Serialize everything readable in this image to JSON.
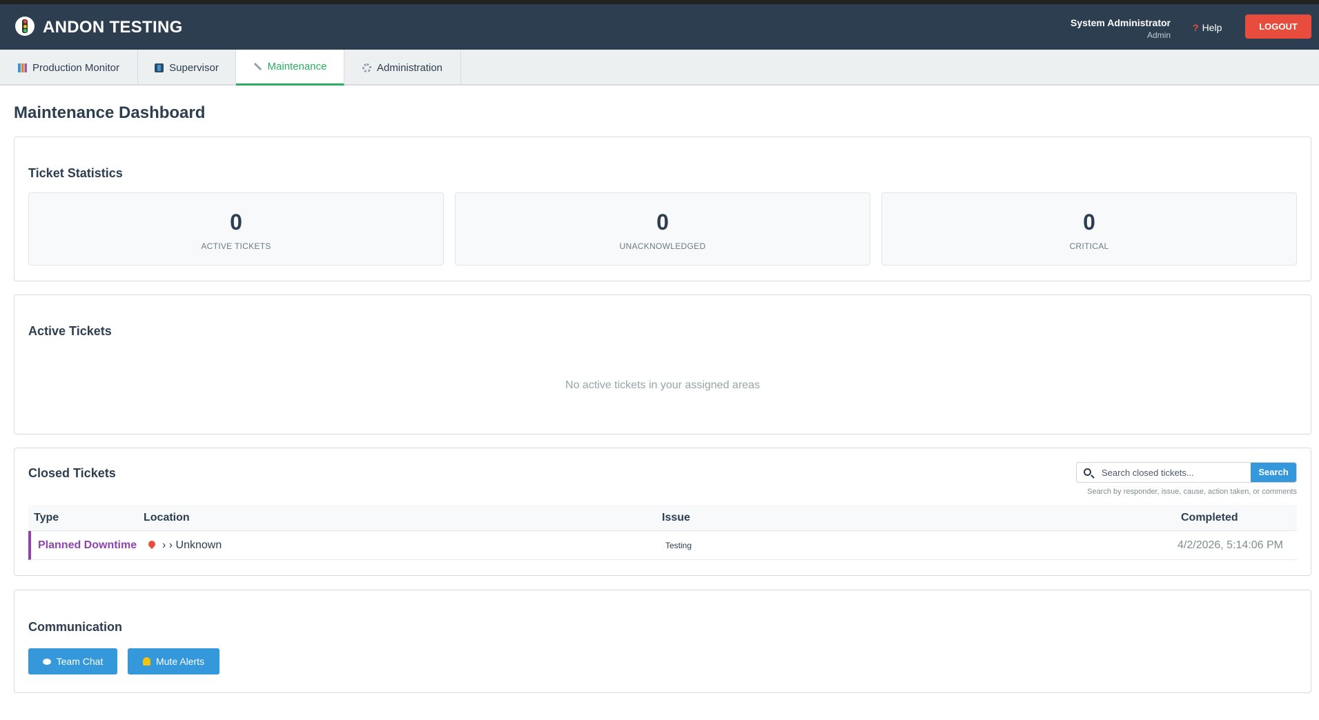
{
  "app": {
    "title": "ANDON TESTING",
    "user_name": "System Administrator",
    "user_role": "Admin",
    "help_label": "Help",
    "logout_label": "LOGOUT"
  },
  "tabs": [
    {
      "label": "Production Monitor",
      "icon": "chart-icon"
    },
    {
      "label": "Supervisor",
      "icon": "supervisor-icon"
    },
    {
      "label": "Maintenance",
      "icon": "wrench-icon",
      "active": true
    },
    {
      "label": "Administration",
      "icon": "gear-icon"
    }
  ],
  "page": {
    "title": "Maintenance Dashboard"
  },
  "stats": {
    "title": "Ticket Statistics",
    "items": [
      {
        "value": "0",
        "label": "ACTIVE TICKETS"
      },
      {
        "value": "0",
        "label": "UNACKNOWLEDGED"
      },
      {
        "value": "0",
        "label": "CRITICAL"
      }
    ]
  },
  "active_tickets": {
    "title": "Active Tickets",
    "empty_message": "No active tickets in your assigned areas"
  },
  "closed_tickets": {
    "title": "Closed Tickets",
    "search_placeholder": "Search closed tickets...",
    "search_button": "Search",
    "search_hint": "Search by responder, issue, cause, action taken, or comments",
    "columns": [
      "Type",
      "Location",
      "Issue",
      "Completed"
    ],
    "rows": [
      {
        "type": "Planned Downtime",
        "location": "› › Unknown",
        "issue": "Testing",
        "completed": "4/2/2026, 5:14:06 PM",
        "type_color": "#8e44ad"
      }
    ]
  },
  "communication": {
    "title": "Communication",
    "team_chat": "Team Chat",
    "mute_alerts": "Mute Alerts"
  },
  "colors": {
    "header_bg": "#2c3e50",
    "accent_green": "#27ae60",
    "logout_red": "#e74c3c",
    "primary_blue": "#3498db"
  }
}
